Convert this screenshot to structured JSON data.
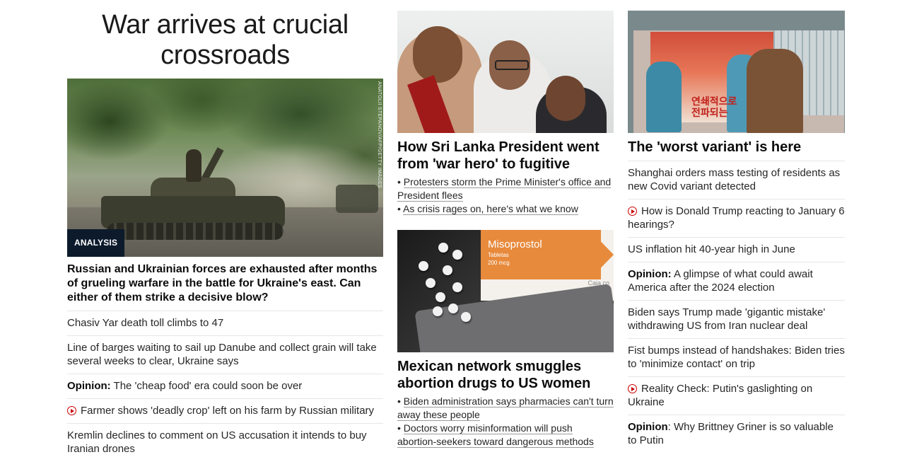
{
  "left": {
    "headline": "War arrives at crucial crossroads",
    "image_credit": "ANATOLII STEPANOV/AFP/GETTY IMAGES",
    "badge": "ANALYSIS",
    "lead": "Russian and Ukrainian forces are exhausted after months of grueling warfare in the battle for Ukraine's east. Can either of them strike a decisive blow?",
    "items": [
      {
        "text": "Chasiv Yar death toll climbs to 47"
      },
      {
        "text": "Line of barges waiting to sail up Danube and collect grain will take several weeks to clear, Ukraine says"
      },
      {
        "label": "Opinion:",
        "text": " The 'cheap food' era could soon be over"
      },
      {
        "video": true,
        "text": "Farmer shows 'deadly crop' left on his farm by Russian military"
      },
      {
        "text": "Kremlin declines to comment on US accusation it intends to buy Iranian drones"
      }
    ]
  },
  "middle": {
    "story1": {
      "headline": "How Sri Lanka President went from 'war hero' to fugitive",
      "bullets": [
        "Protesters storm the Prime Minister's office and President flees",
        "As crisis rages on, here's what we know"
      ]
    },
    "story2": {
      "image_brand": "Misoprostol",
      "image_sub1": "Tabletas",
      "image_sub2": "200 mcg",
      "image_caja": "Caja co",
      "headline": "Mexican network smuggles abortion drugs to US women",
      "bullets": [
        "Biden administration says pharmacies can't turn away these people",
        "Doctors worry misinformation will push abortion-seekers toward dangerous methods"
      ]
    }
  },
  "right": {
    "headline": "The 'worst variant' is here",
    "image_text": "연쇄적으로 전파되는",
    "items": [
      {
        "text": "Shanghai orders mass testing of residents as new Covid variant detected"
      },
      {
        "video": true,
        "text": "How is Donald Trump reacting to January 6 hearings?"
      },
      {
        "text": "US inflation hit 40-year high in June"
      },
      {
        "label": "Opinion:",
        "text": " A glimpse of what could await America after the 2024 election"
      },
      {
        "text": "Biden says Trump made 'gigantic mistake' withdrawing US from Iran nuclear deal"
      },
      {
        "text": "Fist bumps instead of handshakes: Biden tries to 'minimize contact' on trip"
      },
      {
        "video": true,
        "text": "Reality Check: Putin's gaslighting on Ukraine"
      },
      {
        "label": "Opinion",
        "text": ": Why Brittney Griner is so valuable to Putin"
      }
    ]
  },
  "colors": {
    "video_icon": "#cc0000",
    "badge_bg": "#0c1a2c",
    "divider": "#e6e6e6"
  }
}
